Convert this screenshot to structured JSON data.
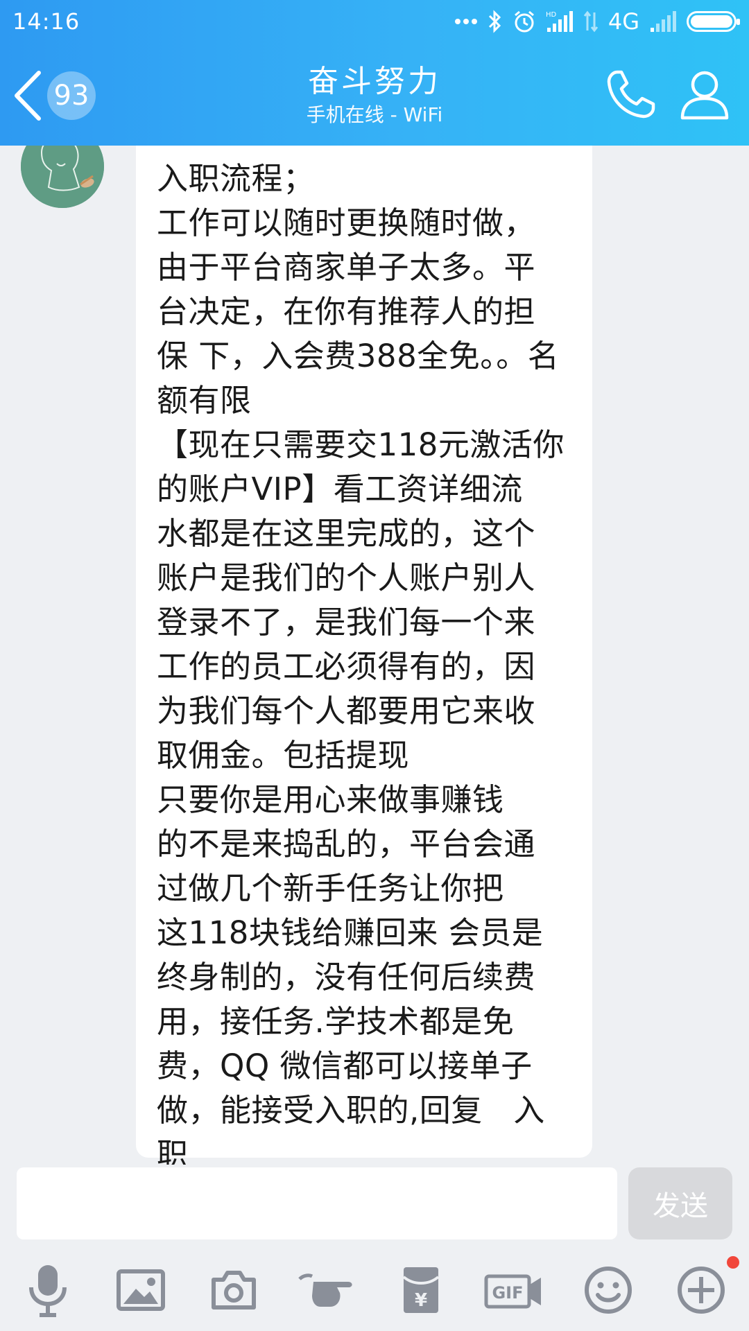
{
  "status_bar": {
    "time": "14:16",
    "network": "4G",
    "battery_level": 1.0
  },
  "header": {
    "unread_count": "93",
    "title": "奋斗努力",
    "subtitle": "手机在线 - WiFi"
  },
  "message": {
    "text": "入职流程；\n工作可以随时更换随时做，\n由于平台商家单子太多。平\n台决定，在你有推荐人的担\n保 下，入会费388全免。。名\n额有限\n【现在只需要交118元激活你\n的账户VIP】看工资详细流\n水都是在这里完成的，这个\n账户是我们的个人账户别人\n登录不了，是我们每一个来\n工作的员工必须得有的，因\n为我们每个人都要用它来收\n取佣金。包括提现\n只要你是用心来做事赚钱\n的不是来捣乱的，平台会通\n过做几个新手任务让你把\n这118块钱给赚回来 会员是\n终身制的，没有任何后续费\n用，接任务.学技术都是免\n费，QQ 微信都可以接单子\n做，能接受入职的,回复   入\n职"
  },
  "input": {
    "value": "",
    "send_label": "发送"
  },
  "toolbar": {
    "gif_label": "GIF"
  },
  "colors": {
    "header_start": "#2e9af2",
    "header_end": "#2fc2f6",
    "send_disabled": "#d8d9dc",
    "icon_gray": "#8a8f99",
    "notification_dot": "#f1473b"
  }
}
